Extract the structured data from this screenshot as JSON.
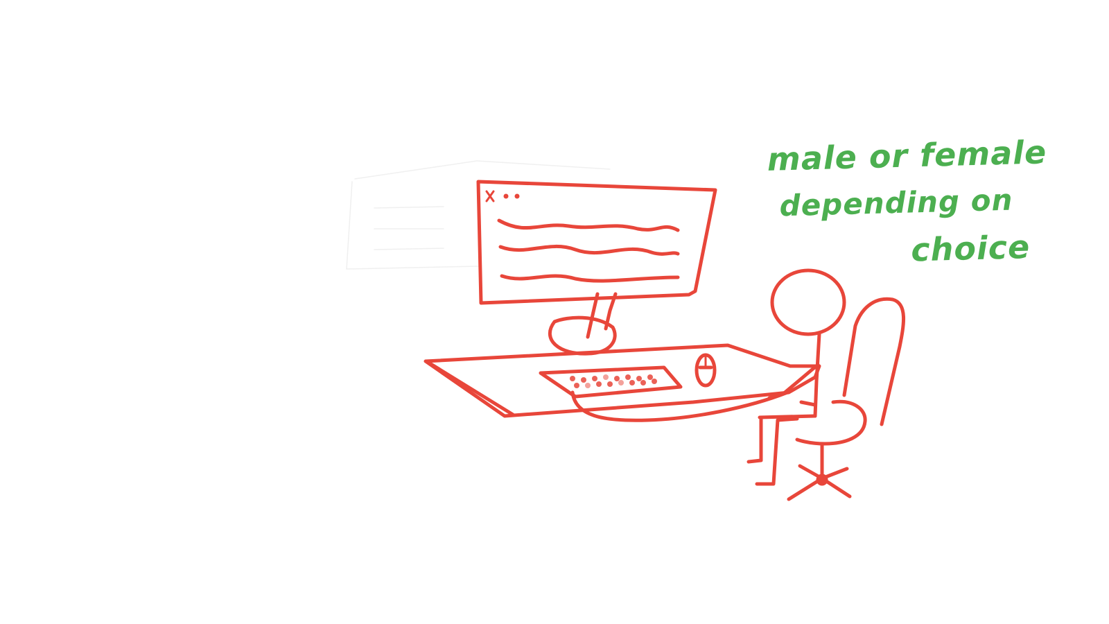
{
  "sketch": {
    "note_lines": [
      "male or female",
      "depending on",
      "choice"
    ]
  },
  "colors": {
    "ink_red": "#e8463a",
    "ink_green": "#4caf50",
    "ghost_gray": "#ececec",
    "background": "#ffffff"
  },
  "icons": {
    "monitor": "monitor-icon",
    "window_controls": "window-dots-icon",
    "keyboard": "keyboard-icon",
    "mouse": "mouse-icon",
    "person": "stick-figure-icon",
    "chair": "office-chair-icon"
  }
}
